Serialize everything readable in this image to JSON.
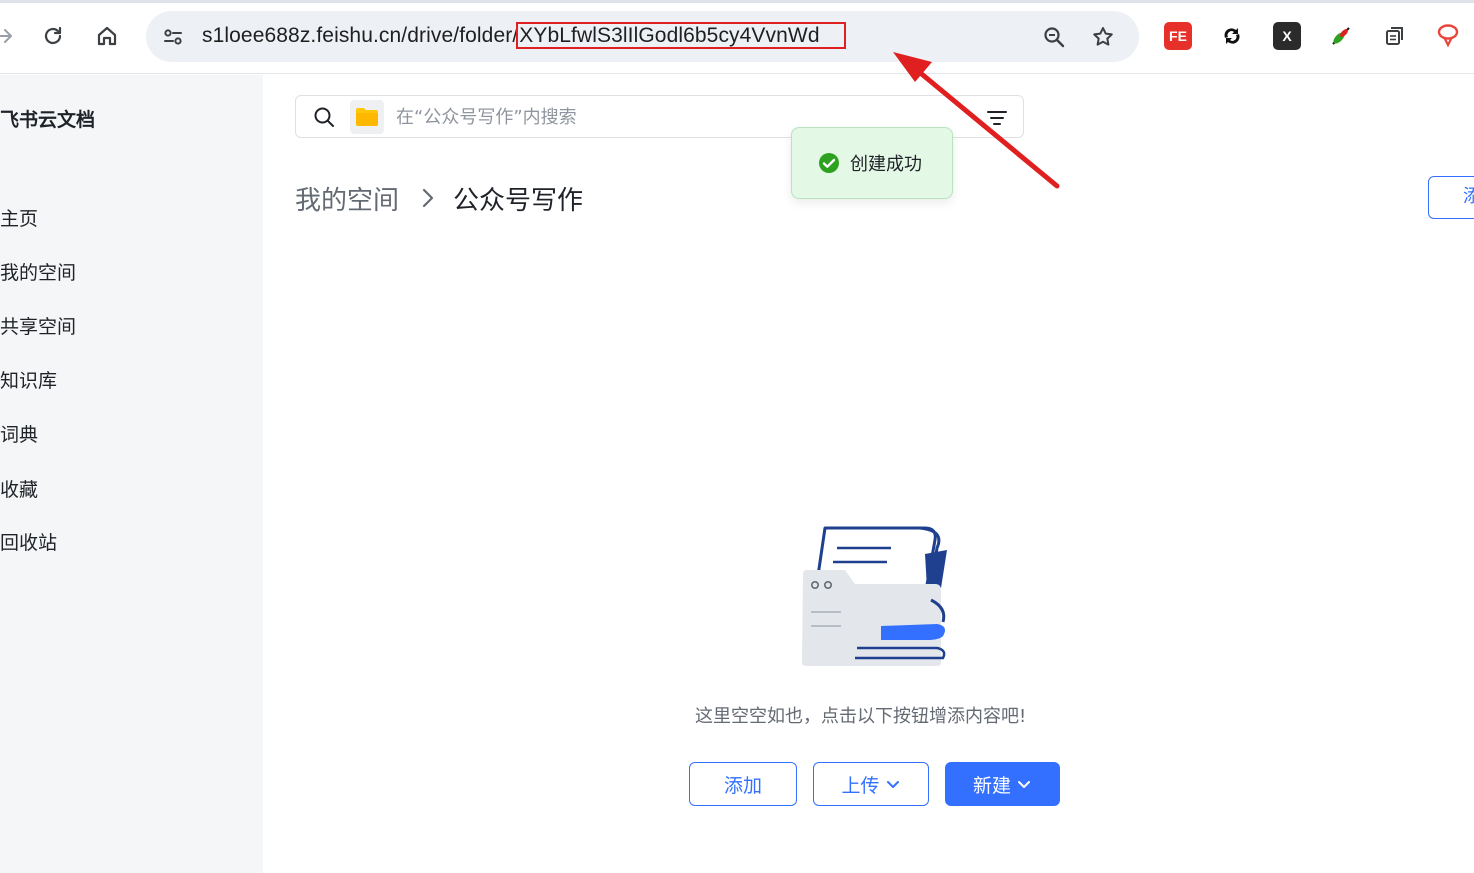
{
  "browser": {
    "url_prefix": "s1loee688z.feishu.cn/drive/folder/",
    "url_highlighted": "XYbLfwlS3lIlGodl6b5cy4VvnWd",
    "extensions": [
      "FE",
      "X"
    ]
  },
  "sidebar": {
    "title": "飞书云文档",
    "items": [
      {
        "label": "主页"
      },
      {
        "label": "我的空间"
      },
      {
        "label": "共享空间"
      },
      {
        "label": "知识库"
      },
      {
        "label": "词典"
      },
      {
        "label": "收藏"
      },
      {
        "label": "回收站"
      }
    ]
  },
  "search": {
    "placeholder": "在“公众号写作”内搜索"
  },
  "breadcrumb": {
    "root": "我的空间",
    "current": "公众号写作"
  },
  "edge_button": {
    "label": "添"
  },
  "toast": {
    "message": "创建成功"
  },
  "empty_state": {
    "message": "这里空空如也，点击以下按钮增添内容吧!",
    "add_label": "添加",
    "upload_label": "上传",
    "new_label": "新建"
  },
  "colors": {
    "primary": "#3370ff",
    "annotation": "#e02020",
    "toast_bg": "#e4f8e6",
    "success": "#2ea121"
  }
}
